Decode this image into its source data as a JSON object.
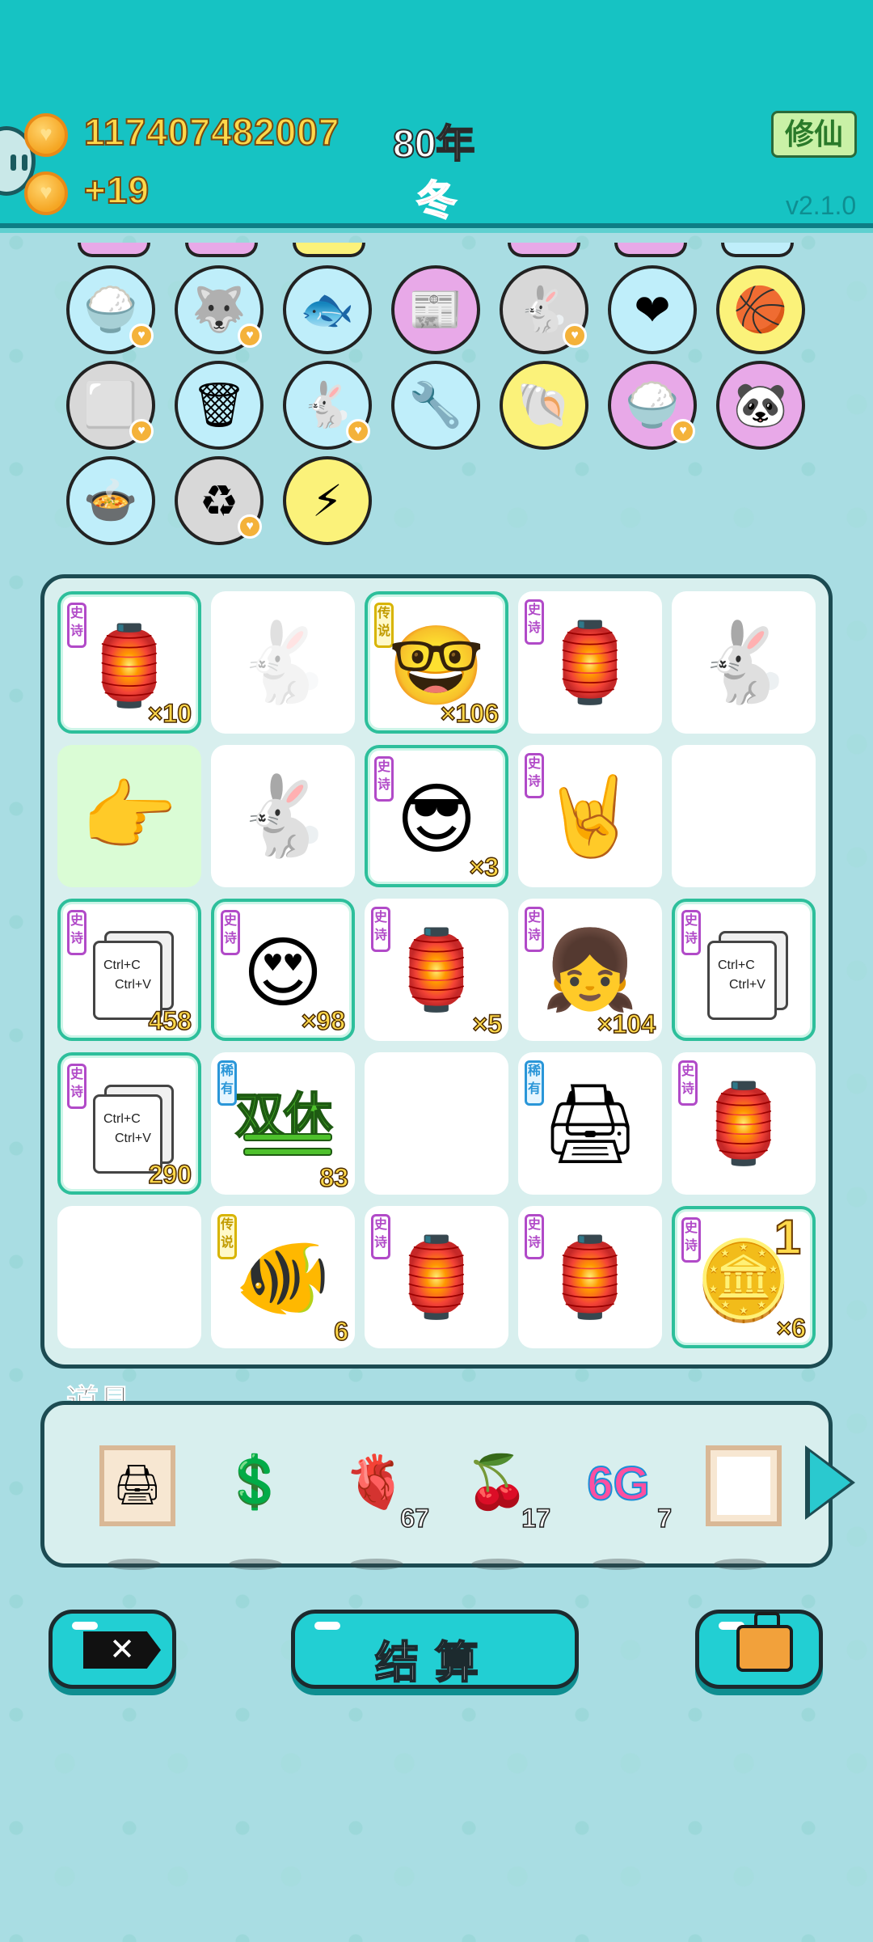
{
  "header": {
    "coins": "117407482007",
    "coin_rate": "+19",
    "year": "80年",
    "season": "冬",
    "xiuxian_button": "修仙",
    "version": "v2.1.0"
  },
  "items": [
    {
      "name": "rice-bowl-icon",
      "glyph": "🍚",
      "bg": "#bfeefa",
      "heart": true
    },
    {
      "name": "husky-icon",
      "glyph": "🐺",
      "bg": "#bfeefa",
      "heart": true
    },
    {
      "name": "fish-tank-icon",
      "glyph": "🐟",
      "bg": "#bfeefa",
      "heart": false
    },
    {
      "name": "time-magazine-icon",
      "glyph": "📰",
      "bg": "#e8a9e8",
      "heart": false
    },
    {
      "name": "rabbit-icon",
      "glyph": "🐇",
      "bg": "#d8d8d8",
      "heart": true
    },
    {
      "name": "heart-fan-icon",
      "glyph": "❤",
      "bg": "#bfeefa",
      "heart": false
    },
    {
      "name": "basketballs-icon",
      "glyph": "🏀",
      "bg": "#fbf27a",
      "heart": false
    },
    {
      "name": "tofu-cubes-icon",
      "glyph": "⬜",
      "bg": "#d8d8d8",
      "heart": true
    },
    {
      "name": "trash-bag-icon",
      "glyph": "🗑",
      "bg": "#bfeefa",
      "heart": false
    },
    {
      "name": "rabbit-icon",
      "glyph": "🐇",
      "bg": "#bfeefa",
      "heart": true
    },
    {
      "name": "air-pump-icon",
      "glyph": "🔧",
      "bg": "#bfeefa",
      "heart": false
    },
    {
      "name": "shell-icon",
      "glyph": "🐚",
      "bg": "#fbf27a",
      "heart": false
    },
    {
      "name": "rice-bowl-icon",
      "glyph": "🍚",
      "bg": "#e8a9e8",
      "heart": true
    },
    {
      "name": "panda-icon",
      "glyph": "🐼",
      "bg": "#e8a9e8",
      "heart": false
    },
    {
      "name": "duck-pot-icon",
      "glyph": "🍲",
      "bg": "#bfeefa",
      "heart": false
    },
    {
      "name": "recycle-icon",
      "glyph": "♻",
      "bg": "#d8d8d8",
      "heart": true
    },
    {
      "name": "lightning-icon",
      "glyph": "⚡",
      "bg": "#fbf27a",
      "heart": false
    }
  ],
  "board": [
    {
      "type": "epic",
      "badge": "史诗",
      "glyph": "🏮",
      "count": "×10",
      "hl": true
    },
    {
      "type": "none",
      "badge": "",
      "glyph": "🐇",
      "count": "",
      "hl": false,
      "faded": true
    },
    {
      "type": "legend",
      "badge": "传说",
      "glyph": "🤓",
      "count": "×106",
      "hl": true
    },
    {
      "type": "epic",
      "badge": "史诗",
      "glyph": "🏮",
      "count": "",
      "hl": false
    },
    {
      "type": "none",
      "badge": "",
      "glyph": "🐇",
      "count": "",
      "hl": false
    },
    {
      "type": "green",
      "badge": "",
      "glyph": "👉",
      "count": "",
      "hl": false
    },
    {
      "type": "none",
      "badge": "",
      "glyph": "🐇",
      "count": "",
      "hl": false
    },
    {
      "type": "epic",
      "badge": "史诗",
      "glyph": "😎",
      "count": "×3",
      "hl": true
    },
    {
      "type": "epic",
      "badge": "史诗",
      "glyph": "🤘",
      "count": "",
      "hl": false
    },
    {
      "type": "empty",
      "badge": "",
      "glyph": "",
      "count": "",
      "hl": false
    },
    {
      "type": "ctrl",
      "badge": "史诗",
      "glyph": "",
      "count": "458",
      "hl": true
    },
    {
      "type": "epic",
      "badge": "史诗",
      "glyph": "😍",
      "count": "×98",
      "hl": true
    },
    {
      "type": "epic",
      "badge": "史诗",
      "glyph": "🏮",
      "count": "×5",
      "hl": false
    },
    {
      "type": "epic",
      "badge": "史诗",
      "glyph": "👧",
      "count": "×104",
      "hl": false
    },
    {
      "type": "ctrl",
      "badge": "史诗",
      "glyph": "",
      "count": "",
      "hl": true
    },
    {
      "type": "ctrl",
      "badge": "史诗",
      "glyph": "",
      "count": "290",
      "hl": true
    },
    {
      "type": "shuang",
      "badge": "稀有",
      "glyph": "",
      "count": "83",
      "hl": false
    },
    {
      "type": "empty",
      "badge": "",
      "glyph": "",
      "count": "",
      "hl": false
    },
    {
      "type": "rare",
      "badge": "稀有",
      "glyph": "🖨",
      "count": "",
      "hl": false
    },
    {
      "type": "epic",
      "badge": "史诗",
      "glyph": "🏮",
      "count": "",
      "hl": false
    },
    {
      "type": "empty",
      "badge": "",
      "glyph": "",
      "count": "",
      "hl": false
    },
    {
      "type": "legend",
      "badge": "传说",
      "glyph": "🐠",
      "count": "6",
      "hl": false
    },
    {
      "type": "epic",
      "badge": "史诗",
      "glyph": "🏮",
      "count": "",
      "hl": false
    },
    {
      "type": "epic",
      "badge": "史诗",
      "glyph": "🏮",
      "count": "",
      "hl": false
    },
    {
      "type": "epic",
      "badge": "史诗",
      "glyph": "🪙",
      "count": "×6",
      "hl": true
    }
  ],
  "board_ctrl_text": [
    "Ctrl+C",
    "Ctrl+V"
  ],
  "board_shuangxiu": "双休",
  "board_coin_overlay": "1",
  "props_title": "道具",
  "props": [
    {
      "name": "printer-frame-icon",
      "glyph": "🖨",
      "count": ""
    },
    {
      "name": "dollar-coin-icon",
      "glyph": "💲",
      "count": ""
    },
    {
      "name": "liver-icon",
      "glyph": "🫀",
      "count": "67"
    },
    {
      "name": "lychee-icon",
      "glyph": "🍒",
      "count": "17"
    },
    {
      "name": "6g-icon",
      "glyph": "6G",
      "count": "7"
    },
    {
      "name": "blank-frame-icon",
      "glyph": "",
      "count": ""
    }
  ],
  "buttons": {
    "settle": "结算"
  }
}
